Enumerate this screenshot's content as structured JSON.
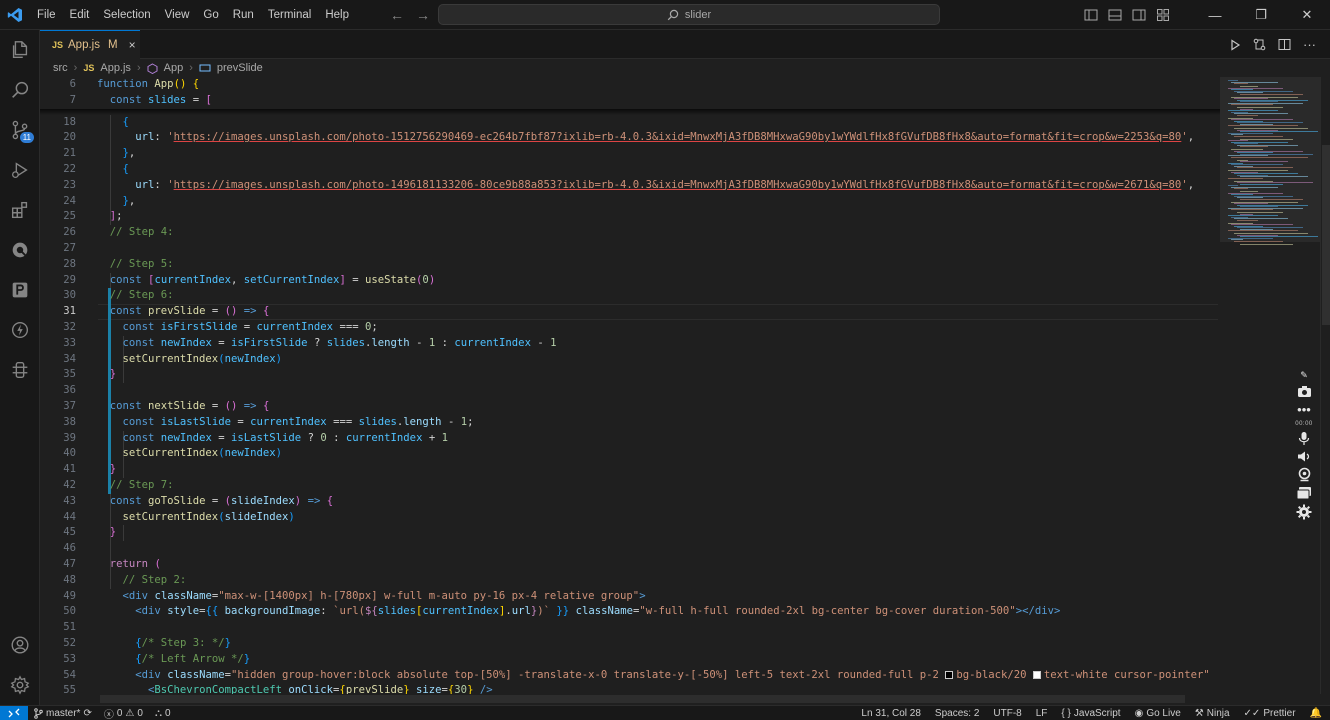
{
  "menu": [
    "File",
    "Edit",
    "Selection",
    "View",
    "Go",
    "Run",
    "Terminal",
    "Help"
  ],
  "search": {
    "text": "slider"
  },
  "tab": {
    "badge": "JS",
    "name": "App.js",
    "modified": "M",
    "close": "×"
  },
  "breadcrumb": [
    "src",
    "App.js",
    "App",
    "prevSlide"
  ],
  "breadcrumb_badges": {
    "js": "JS"
  },
  "activity_badge": "11",
  "sticky": [
    {
      "n": "6",
      "html": "<span class='kw'>function</span> <span class='fn'>App</span><span class='br1'>()</span> <span class='br1'>{</span>"
    },
    {
      "n": "7",
      "html": "  <span class='kw'>const</span> <span class='cst'>slides</span> <span class='pun'>=</span> <span class='br2'>[</span>"
    }
  ],
  "lines": [
    {
      "n": "18",
      "html": "    <span class='br3'>{</span>"
    },
    {
      "n": "20",
      "html": "      <span class='var'>url</span><span class='pun'>:</span> <span class='str'>'</span><span class='url'>https://images.unsplash.com/photo-1512756290469-ec264b7fbf87?ixlib=rb-4.0.3&amp;ixid=MnwxMjA3fDB8MHxwaG90by1wYWdlfHx8fGVufDB8fHx8&amp;auto=format&amp;fit=crop&amp;w=2253&amp;q=80</span><span class='str'>'</span><span class='pun'>,</span>"
    },
    {
      "n": "21",
      "html": "    <span class='br3'>}</span><span class='pun'>,</span>"
    },
    {
      "n": "22",
      "html": "    <span class='br3'>{</span>"
    },
    {
      "n": "23",
      "html": "      <span class='var'>url</span><span class='pun'>:</span> <span class='str'>'</span><span class='url'>https://images.unsplash.com/photo-1496181133206-80ce9b88a853?ixlib=rb-4.0.3&amp;ixid=MnwxMjA3fDB8MHxwaG90by1wYWdlfHx8fGVufDB8fHx8&amp;auto=format&amp;fit=crop&amp;w=2671&amp;q=80</span><span class='str'>'</span><span class='pun'>,</span>"
    },
    {
      "n": "24",
      "html": "    <span class='br3'>}</span><span class='pun'>,</span>"
    },
    {
      "n": "25",
      "html": "  <span class='br2'>]</span><span class='pun'>;</span>"
    },
    {
      "n": "26",
      "html": "  <span class='cm'>// Step 4:</span>"
    },
    {
      "n": "27",
      "html": ""
    },
    {
      "n": "28",
      "html": "  <span class='cm'>// Step 5:</span>"
    },
    {
      "n": "29",
      "html": "  <span class='kw'>const</span> <span class='br2'>[</span><span class='cst'>currentIndex</span><span class='pun'>,</span> <span class='cst'>setCurrentIndex</span><span class='br2'>]</span> <span class='pun'>=</span> <span class='fn'>useState</span><span class='br2'>(</span><span class='num'>0</span><span class='br2'>)</span>"
    },
    {
      "n": "30",
      "html": "  <span class='cm'>// Step 6:</span>"
    },
    {
      "n": "31",
      "html": "  <span class='kw'>const</span> <span class='fn'>prevSlide</span> <span class='pun'>=</span> <span class='br2'>()</span> <span class='kw'>=&gt;</span> <span class='br2'>{</span>",
      "current": true
    },
    {
      "n": "32",
      "html": "    <span class='kw'>const</span> <span class='cst'>isFirstSlide</span> <span class='pun'>=</span> <span class='cst'>currentIndex</span> <span class='pun'>===</span> <span class='num'>0</span><span class='pun'>;</span>"
    },
    {
      "n": "33",
      "html": "    <span class='kw'>const</span> <span class='cst'>newIndex</span> <span class='pun'>=</span> <span class='cst'>isFirstSlide</span> <span class='pun'>?</span> <span class='cst'>slides</span><span class='pun'>.</span><span class='var'>length</span> <span class='pun'>-</span> <span class='num'>1</span> <span class='pun'>:</span> <span class='cst'>currentIndex</span> <span class='pun'>-</span> <span class='num'>1</span>"
    },
    {
      "n": "34",
      "html": "    <span class='fn'>setCurrentIndex</span><span class='br3'>(</span><span class='cst'>newIndex</span><span class='br3'>)</span>"
    },
    {
      "n": "35",
      "html": "  <span class='br2'>}</span>"
    },
    {
      "n": "36",
      "html": ""
    },
    {
      "n": "37",
      "html": "  <span class='kw'>const</span> <span class='fn'>nextSlide</span> <span class='pun'>=</span> <span class='br2'>()</span> <span class='kw'>=&gt;</span> <span class='br2'>{</span>"
    },
    {
      "n": "38",
      "html": "    <span class='kw'>const</span> <span class='cst'>isLastSlide</span> <span class='pun'>=</span> <span class='cst'>currentIndex</span> <span class='pun'>===</span> <span class='cst'>slides</span><span class='pun'>.</span><span class='var'>length</span> <span class='pun'>-</span> <span class='num'>1</span><span class='pun'>;</span>"
    },
    {
      "n": "39",
      "html": "    <span class='kw'>const</span> <span class='cst'>newIndex</span> <span class='pun'>=</span> <span class='cst'>isLastSlide</span> <span class='pun'>?</span> <span class='num'>0</span> <span class='pun'>:</span> <span class='cst'>currentIndex</span> <span class='pun'>+</span> <span class='num'>1</span>"
    },
    {
      "n": "40",
      "html": "    <span class='fn'>setCurrentIndex</span><span class='br3'>(</span><span class='cst'>newIndex</span><span class='br3'>)</span>"
    },
    {
      "n": "41",
      "html": "  <span class='br2'>}</span>"
    },
    {
      "n": "42",
      "html": "  <span class='cm'>// Step 7:</span>"
    },
    {
      "n": "43",
      "html": "  <span class='kw'>const</span> <span class='fn'>goToSlide</span> <span class='pun'>=</span> <span class='br2'>(</span><span class='var'>slideIndex</span><span class='br2'>)</span> <span class='kw'>=&gt;</span> <span class='br2'>{</span>"
    },
    {
      "n": "44",
      "html": "    <span class='fn'>setCurrentIndex</span><span class='br3'>(</span><span class='var'>slideIndex</span><span class='br3'>)</span>"
    },
    {
      "n": "45",
      "html": "  <span class='br2'>}</span>"
    },
    {
      "n": "46",
      "html": ""
    },
    {
      "n": "47",
      "html": "  <span class='ctl'>return</span> <span class='br2'>(</span>"
    },
    {
      "n": "48",
      "html": "    <span class='cm'>// Step 2:</span>"
    },
    {
      "n": "49",
      "html": "    <span class='kw'>&lt;</span><span class='kw'>div</span> <span class='attr'>className</span><span class='pun'>=</span><span class='str'>\"max-w-[1400px] h-[780px] w-full m-auto py-16 px-4 relative group\"</span><span class='kw'>&gt;</span>"
    },
    {
      "n": "50",
      "html": "      <span class='kw'>&lt;div</span> <span class='attr'>style</span><span class='pun'>=</span><span class='br3'>{{</span> <span class='var'>backgroundImage</span><span class='pun'>:</span> <span class='str'>`url(</span><span class='ctl'>${</span><span class='cst'>slides</span><span class='br1'>[</span><span class='cst'>currentIndex</span><span class='br1'>]</span><span class='pun'>.</span><span class='var'>url</span><span class='ctl'>}</span><span class='str'>)`</span> <span class='br3'>}}</span> <span class='attr'>className</span><span class='pun'>=</span><span class='str'>\"w-full h-full rounded-2xl bg-center bg-cover duration-500\"</span><span class='kw'>&gt;&lt;/div&gt;</span>"
    },
    {
      "n": "51",
      "html": ""
    },
    {
      "n": "52",
      "html": "      <span class='br3'>{</span><span class='cm'>/* Step 3: */</span><span class='br3'>}</span>"
    },
    {
      "n": "53",
      "html": "      <span class='br3'>{</span><span class='cm'>/* Left Arrow */</span><span class='br3'>}</span>"
    },
    {
      "n": "54",
      "html": "      <span class='kw'>&lt;div</span> <span class='attr'>className</span><span class='pun'>=</span><span class='str'>\"hidden group-hover:block absolute top-[50%] -translate-x-0 translate-y-[-50%] left-5 text-2xl rounded-full p-2 </span><span class='box black'></span><span class='str'>bg-black/20 </span><span class='box white'></span><span class='str'>text-white cursor-pointer\"</span>"
    },
    {
      "n": "55",
      "html": "        <span class='kw'>&lt;</span><span class='tag'>BsChevronCompactLeft</span> <span class='attr'>onClick</span><span class='pun'>=</span><span class='br1'>{</span><span class='fn'>prevSlide</span><span class='br1'>}</span> <span class='attr'>size</span><span class='pun'>=</span><span class='br1'>{</span><span class='num'>30</span><span class='br1'>}</span> <span class='kw'>/&gt;</span>"
    }
  ],
  "status": {
    "branch": "master*",
    "sync": "",
    "errors": "0",
    "warnings": "0",
    "ports": "0",
    "position": "Ln 31, Col 28",
    "spaces": "Spaces: 2",
    "encoding": "UTF-8",
    "eol": "LF",
    "language": "JavaScript",
    "golive": "Go Live",
    "ninja": "Ninja",
    "prettier": "Prettier"
  },
  "float_tools": {
    "time": "00:00"
  },
  "colors": {
    "accent": "#0078d4",
    "background": "#1f1f1f"
  }
}
